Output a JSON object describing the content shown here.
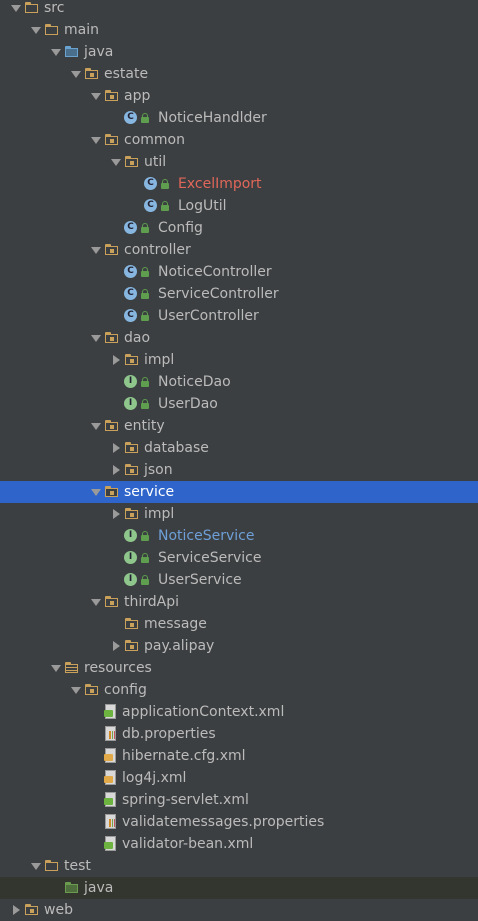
{
  "tree": [
    {
      "label": "src",
      "depth": 0,
      "arrow": "down",
      "icon": "folder"
    },
    {
      "label": "main",
      "depth": 1,
      "arrow": "down",
      "icon": "folder"
    },
    {
      "label": "java",
      "depth": 2,
      "arrow": "down",
      "icon": "folder-blue"
    },
    {
      "label": "estate",
      "depth": 3,
      "arrow": "down",
      "icon": "package"
    },
    {
      "label": "app",
      "depth": 4,
      "arrow": "down",
      "icon": "package"
    },
    {
      "label": "NoticeHandlder",
      "depth": 5,
      "arrow": "none",
      "icon": "class"
    },
    {
      "label": "common",
      "depth": 4,
      "arrow": "down",
      "icon": "package"
    },
    {
      "label": "util",
      "depth": 5,
      "arrow": "down",
      "icon": "package"
    },
    {
      "label": "ExcelImport",
      "depth": 6,
      "arrow": "none",
      "icon": "class",
      "color": "red"
    },
    {
      "label": "LogUtil",
      "depth": 6,
      "arrow": "none",
      "icon": "class"
    },
    {
      "label": "Config",
      "depth": 5,
      "arrow": "none",
      "icon": "class"
    },
    {
      "label": "controller",
      "depth": 4,
      "arrow": "down",
      "icon": "package"
    },
    {
      "label": "NoticeController",
      "depth": 5,
      "arrow": "none",
      "icon": "class"
    },
    {
      "label": "ServiceController",
      "depth": 5,
      "arrow": "none",
      "icon": "class"
    },
    {
      "label": "UserController",
      "depth": 5,
      "arrow": "none",
      "icon": "class"
    },
    {
      "label": "dao",
      "depth": 4,
      "arrow": "down",
      "icon": "package"
    },
    {
      "label": "impl",
      "depth": 5,
      "arrow": "right",
      "icon": "package"
    },
    {
      "label": "NoticeDao",
      "depth": 5,
      "arrow": "none",
      "icon": "interface"
    },
    {
      "label": "UserDao",
      "depth": 5,
      "arrow": "none",
      "icon": "interface"
    },
    {
      "label": "entity",
      "depth": 4,
      "arrow": "down",
      "icon": "package"
    },
    {
      "label": "database",
      "depth": 5,
      "arrow": "right",
      "icon": "package"
    },
    {
      "label": "json",
      "depth": 5,
      "arrow": "right",
      "icon": "package"
    },
    {
      "label": "service",
      "depth": 4,
      "arrow": "down",
      "icon": "package",
      "selected": true
    },
    {
      "label": "impl",
      "depth": 5,
      "arrow": "right",
      "icon": "package"
    },
    {
      "label": "NoticeService",
      "depth": 5,
      "arrow": "none",
      "icon": "interface",
      "color": "blue"
    },
    {
      "label": "ServiceService",
      "depth": 5,
      "arrow": "none",
      "icon": "interface"
    },
    {
      "label": "UserService",
      "depth": 5,
      "arrow": "none",
      "icon": "interface"
    },
    {
      "label": "thirdApi",
      "depth": 4,
      "arrow": "down",
      "icon": "package"
    },
    {
      "label": "message",
      "depth": 5,
      "arrow": "none",
      "icon": "package"
    },
    {
      "label": "pay.alipay",
      "depth": 5,
      "arrow": "right",
      "icon": "package"
    },
    {
      "label": "resources",
      "depth": 2,
      "arrow": "down",
      "icon": "folder-res"
    },
    {
      "label": "config",
      "depth": 3,
      "arrow": "down",
      "icon": "package"
    },
    {
      "label": "applicationContext.xml",
      "depth": 4,
      "arrow": "none",
      "icon": "spring-xml"
    },
    {
      "label": "db.properties",
      "depth": 4,
      "arrow": "none",
      "icon": "properties"
    },
    {
      "label": "hibernate.cfg.xml",
      "depth": 4,
      "arrow": "none",
      "icon": "xml"
    },
    {
      "label": "log4j.xml",
      "depth": 4,
      "arrow": "none",
      "icon": "xml"
    },
    {
      "label": "spring-servlet.xml",
      "depth": 4,
      "arrow": "none",
      "icon": "spring-xml"
    },
    {
      "label": "validatemessages.properties",
      "depth": 4,
      "arrow": "none",
      "icon": "properties"
    },
    {
      "label": "validator-bean.xml",
      "depth": 4,
      "arrow": "none",
      "icon": "spring-xml"
    },
    {
      "label": "test",
      "depth": 1,
      "arrow": "down",
      "icon": "folder"
    },
    {
      "label": "java",
      "depth": 2,
      "arrow": "none",
      "icon": "folder-green",
      "hover": true
    },
    {
      "label": "web",
      "depth": 0,
      "arrow": "right",
      "icon": "folder-web"
    }
  ],
  "colors": {
    "background": "#3c3f41",
    "selection": "#2f65ca",
    "text": "#bbbbbb",
    "error_text": "#e0675a",
    "modified_text": "#6e9fd8"
  }
}
